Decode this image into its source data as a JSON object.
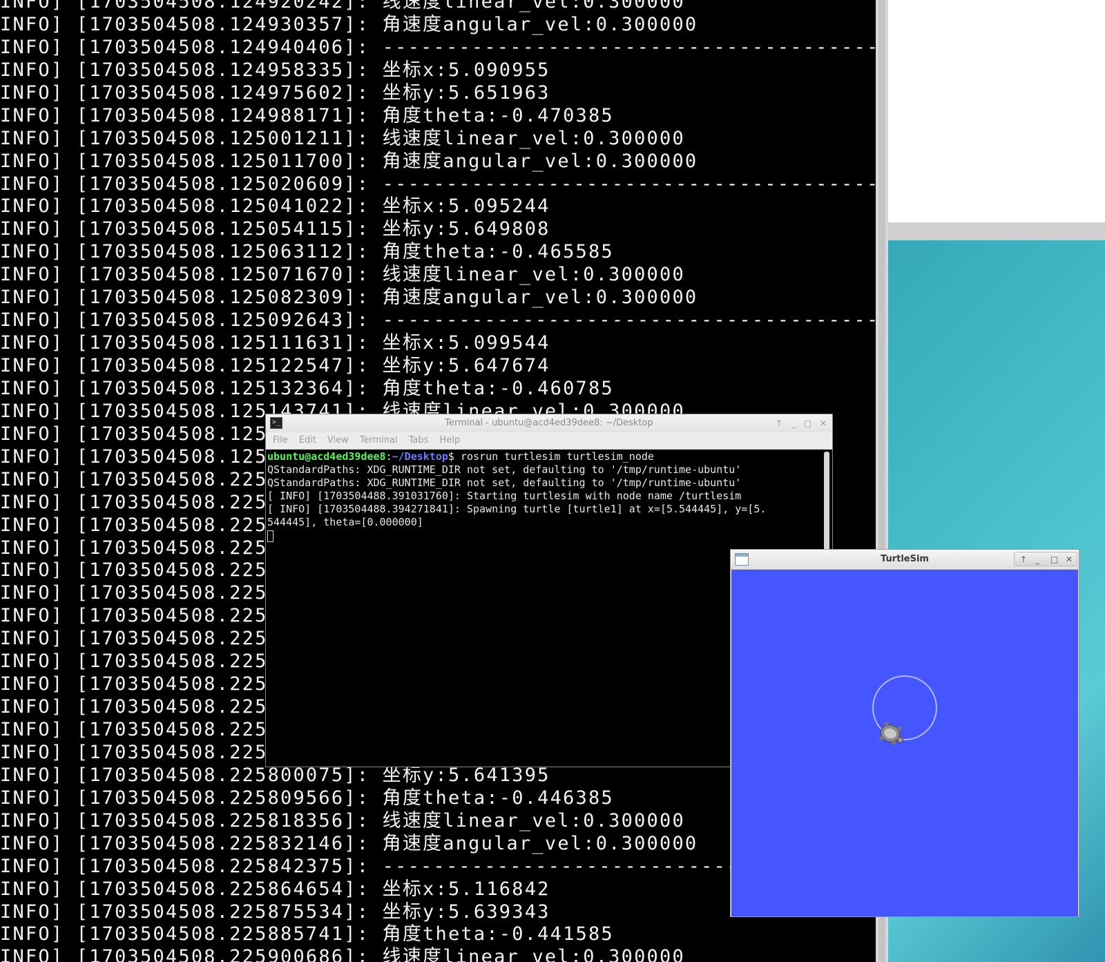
{
  "background_terminal": {
    "lines": [
      "INFO] [1703504508.124920242]: 线速度linear_vel:0.300000",
      "INFO] [1703504508.124930357]: 角速度angular_vel:0.300000",
      "INFO] [1703504508.124940406]: -------------------------------------------",
      "INFO] [1703504508.124958335]: 坐标x:5.090955",
      "INFO] [1703504508.124975602]: 坐标y:5.651963",
      "INFO] [1703504508.124988171]: 角度theta:-0.470385",
      "INFO] [1703504508.125001211]: 线速度linear_vel:0.300000",
      "INFO] [1703504508.125011700]: 角速度angular_vel:0.300000",
      "INFO] [1703504508.125020609]: -------------------------------------------",
      "INFO] [1703504508.125041022]: 坐标x:5.095244",
      "INFO] [1703504508.125054115]: 坐标y:5.649808",
      "INFO] [1703504508.125063112]: 角度theta:-0.465585",
      "INFO] [1703504508.125071670]: 线速度linear_vel:0.300000",
      "INFO] [1703504508.125082309]: 角速度angular_vel:0.300000",
      "INFO] [1703504508.125092643]: -------------------------------------------",
      "INFO] [1703504508.125111631]: 坐标x:5.099544",
      "INFO] [1703504508.125122547]: 坐标y:5.647674",
      "INFO] [1703504508.125132364]: 角度theta:-0.460785",
      "INFO] [1703504508.125143741]: 线速度linear_vel:0.300000",
      "INFO] [1703504508.125",
      "INFO] [1703504508.125                                                ----",
      "INFO] [1703504508.225",
      "INFO] [1703504508.225",
      "INFO] [1703504508.225",
      "INFO] [1703504508.225",
      "INFO] [1703504508.225",
      "INFO] [1703504508.225",
      "INFO] [1703504508.225",
      "INFO] [1703504508.225",
      "INFO] [1703504508.225",
      "INFO] [1703504508.225",
      "INFO] [1703504508.225",
      "INFO] [1703504508.225",
      "INFO] [1703504508.225",
      "INFO] [1703504508.225800075]: 坐标y:5.641395",
      "INFO] [1703504508.225809566]: 角度theta:-0.446385",
      "INFO] [1703504508.225818356]: 线速度linear_vel:0.300000",
      "INFO] [1703504508.225832146]: 角速度angular_vel:0.300000",
      "INFO] [1703504508.225842375]: -------------------------------------------",
      "INFO] [1703504508.225864654]: 坐标x:5.116842",
      "INFO] [1703504508.225875534]: 坐标y:5.639343",
      "INFO] [1703504508.225885741]: 角度theta:-0.441585",
      "INFO] [1703504508.225900686]: 线速度linear_vel:0.300000"
    ]
  },
  "terminal_window": {
    "title": "Terminal - ubuntu@acd4ed39dee8: ~/Desktop",
    "controls": {
      "up": "↑",
      "minimize": "_",
      "maximize": "□",
      "close": "✕"
    },
    "menu": [
      "File",
      "Edit",
      "View",
      "Terminal",
      "Tabs",
      "Help"
    ],
    "prompt_user": "ubuntu@acd4ed39dee8",
    "prompt_colon": ":",
    "prompt_path": "~/Desktop",
    "prompt_symbol": "$",
    "command": " rosrun turtlesim turtlesim_node",
    "output": [
      "QStandardPaths: XDG_RUNTIME_DIR not set, defaulting to '/tmp/runtime-ubuntu'",
      "QStandardPaths: XDG_RUNTIME_DIR not set, defaulting to '/tmp/runtime-ubuntu'",
      "[ INFO] [1703504488.391031760]: Starting turtlesim with node name /turtlesim",
      "[ INFO] [1703504488.394271841]: Spawning turtle [turtle1] at x=[5.544445], y=[5.",
      "544445], theta=[0.000000]"
    ]
  },
  "turtlesim_window": {
    "title": "TurtleSim",
    "controls": {
      "up": "↑",
      "minimize": "_",
      "maximize": "□",
      "close": "✕"
    },
    "canvas_color": "#4556ff",
    "pen_color": "#b3b8ff"
  },
  "desktop": {
    "accent_color": "#49c1cc"
  }
}
